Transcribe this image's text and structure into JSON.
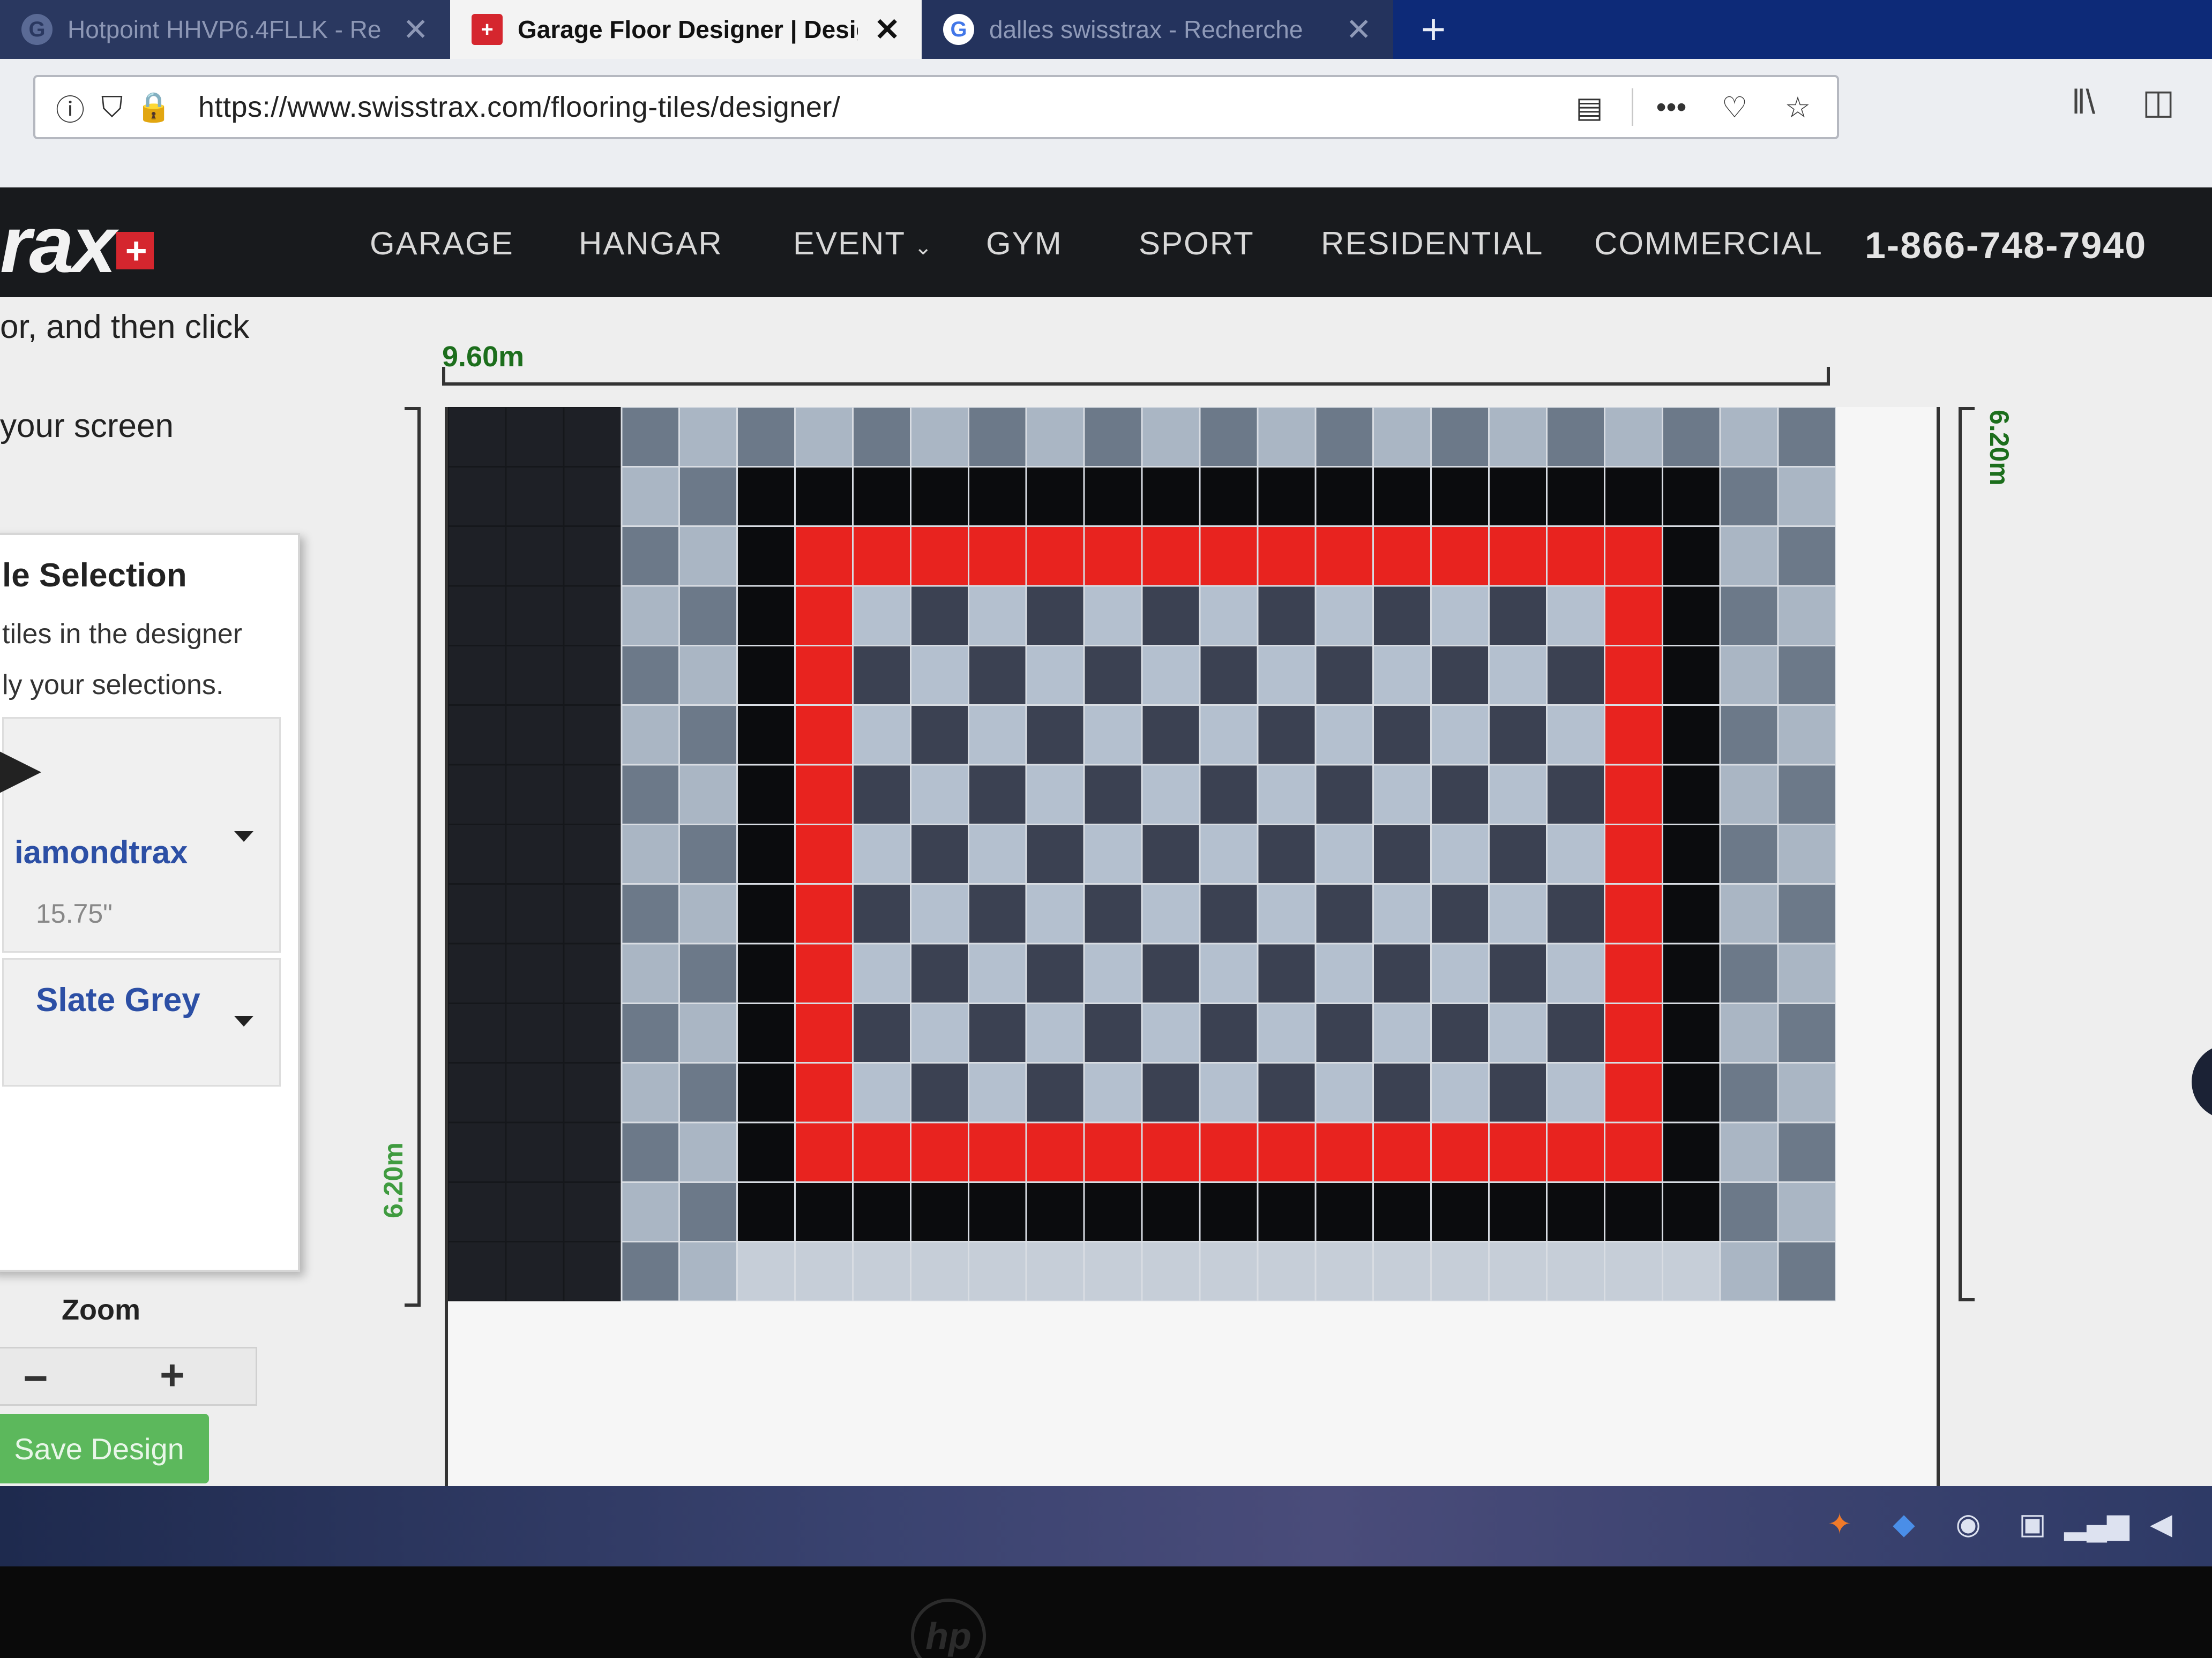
{
  "browser": {
    "tabs": [
      {
        "title": "Hotpoint HHVP6.4FLLK - Re",
        "favicon": "google-icon"
      },
      {
        "title": "Garage Floor Designer | Design",
        "favicon": "swisstrax-icon",
        "active": true
      },
      {
        "title": "dalles swisstrax - Recherche",
        "favicon": "google-icon"
      }
    ],
    "new_tab_label": "+",
    "close_label": "✕",
    "url": "https://www.swisstrax.com/flooring-tiles/designer/"
  },
  "site": {
    "logo_text": "rax",
    "logo_plus": "+",
    "nav": {
      "garage": "GARAGE",
      "hangar": "HANGAR",
      "event": "EVENT",
      "gym": "GYM",
      "sport": "SPORT",
      "residential": "RESIDENTIAL",
      "commercial": "COMMERCIAL"
    },
    "phone": "1-866-748-7940"
  },
  "instructions": {
    "line1": "or, and then click",
    "line2": "your screen"
  },
  "tile_panel": {
    "title": "le Selection",
    "desc1": "tiles in the designer",
    "desc2": "ly your selections.",
    "tile_type": "iamondtrax",
    "tile_size": "15.75\"",
    "tile_color": "Slate Grey"
  },
  "zoom": {
    "label": "Zoom",
    "minus": "−",
    "plus": "+"
  },
  "save_label": "Save Design",
  "dimensions": {
    "width": "9.60m",
    "height": "6.20m"
  },
  "floor": {
    "cols": 24,
    "rows": 15,
    "colors": {
      "base": "#1e2026",
      "slate": "#6c7989",
      "light": "#aab6c4",
      "black": "#0b0c0e",
      "red": "#e8231f",
      "check_light": "#b4c0cf",
      "check_dark": "#3b4152",
      "bottom_light": "#c6ced8"
    }
  }
}
